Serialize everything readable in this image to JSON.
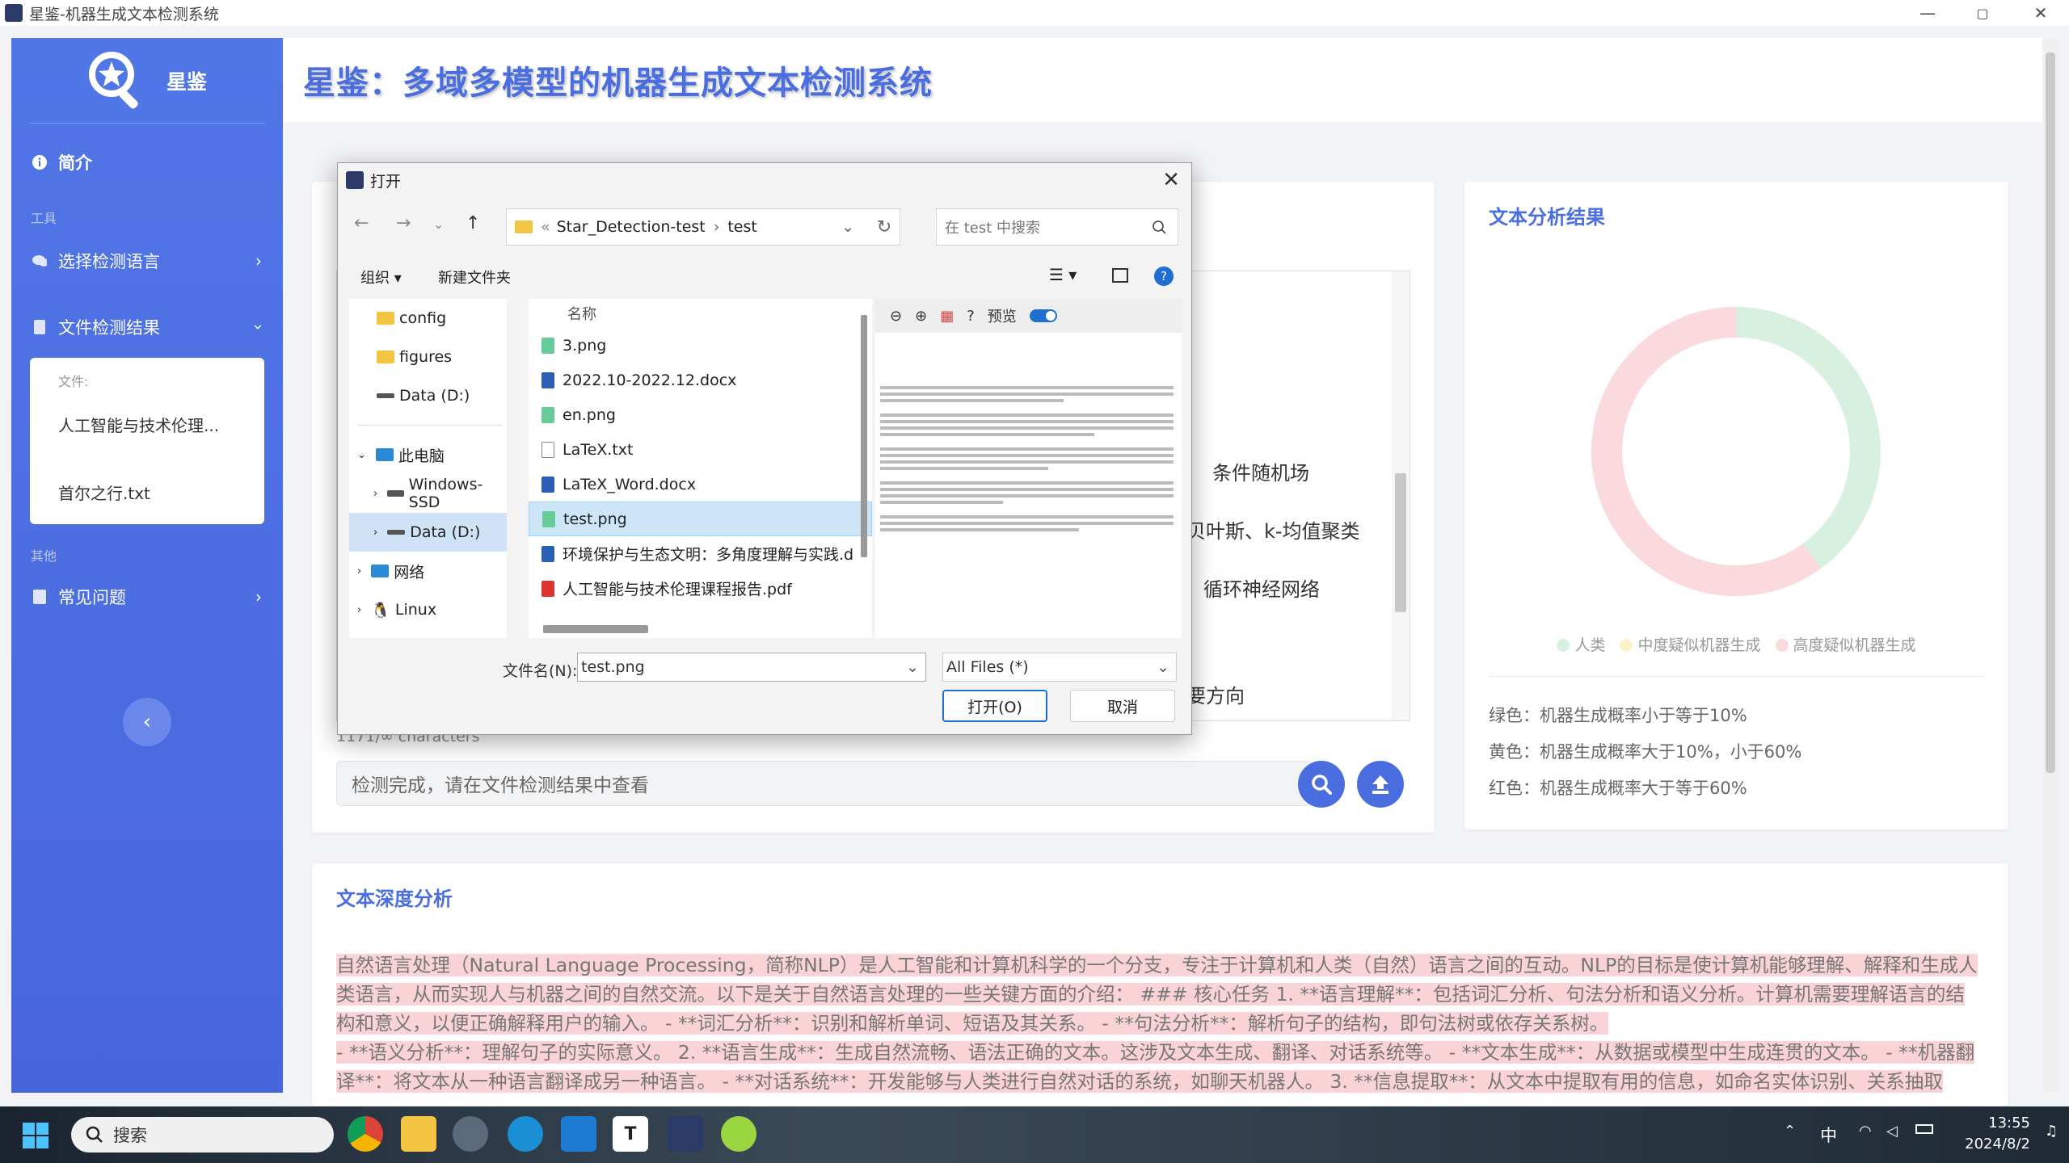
{
  "window": {
    "title": "星鉴-机器生成文本检测系统",
    "min": "—",
    "max": "▢",
    "close": "✕"
  },
  "sidebar": {
    "logo_text": "星鉴",
    "intro": "简介",
    "tools_heading": "工具",
    "select_language": "选择检测语言",
    "file_results": "文件检测结果",
    "file_heading": "文件:",
    "files": [
      "人工智能与技术伦理...",
      "首尔之行.txt"
    ],
    "other_heading": "其他",
    "faq": "常见问题",
    "collapse_icon": "‹"
  },
  "header": {
    "title": "星鉴：多域多模型的机器生成文本检测系统"
  },
  "input_card": {
    "visible_lines": [
      "条件随机场",
      "贝叶斯、k-均值聚类",
      "循环神经网络",
      "要方向"
    ],
    "char_count": "1171/∞ characters",
    "status_text": "检测完成，请在文件检测结果中查看"
  },
  "result_card": {
    "title": "文本分析结果",
    "legend": [
      "人类",
      "中度疑似机器生成",
      "高度疑似机器生成"
    ],
    "lines": [
      "绿色：机器生成概率小于等于10%",
      "黄色：机器生成概率大于10%，小于60%",
      "红色：机器生成概率大于等于60%"
    ]
  },
  "chart_data": {
    "type": "pie",
    "categories": [
      "人类",
      "中度疑似机器生成",
      "高度疑似机器生成"
    ],
    "values": [
      40,
      0,
      60
    ],
    "colors": [
      "#d7f0df",
      "#fdf2cc",
      "#fadadd"
    ]
  },
  "deep_card": {
    "title": "文本深度分析",
    "text_l1": "自然语言处理（Natural Language Processing，简称NLP）是人工智能和计算机科学的一个分支，专注于计算机和人类（自然）语言之间的互动。NLP的目标是使计算机能够理解、解释和生成人",
    "text_l2": "类语言，从而实现人与机器之间的自然交流。以下是关于自然语言处理的一些关键方面的介绍：  ### 核心任务 1. **语言理解**：包括词汇分析、句法分析和语义分析。计算机需要理解语言的结",
    "text_l3": "构和意义，以便正确解释用户的输入。 - **词汇分析**：识别和解析单词、短语及其关系。 - **句法分析**：解析句子的结构，即句法树或依存关系树。",
    "text_l4": "- **语义分析**：理解句子的实际意义。  2. **语言生成**：生成自然流畅、语法正确的文本。这涉及文本生成、翻译、对话系统等。 - **文本生成**：从数据或模型中生成连贯的文本。 - **机器翻",
    "text_l5": "译**：将文本从一种语言翻译成另一种语言。 - **对话系统**：开发能够与人类进行自然对话的系统，如聊天机器人。 3. **信息提取**：从文本中提取有用的信息，如命名实体识别、关系抽取"
  },
  "dialog": {
    "title": "打开",
    "path_prefix": "«",
    "path_root": "Star_Detection-test",
    "path_sep": "›",
    "path_leaf": "test",
    "search_placeholder": "在 test 中搜索",
    "organize": "组织 ▾",
    "new_folder": "新建文件夹",
    "tree": [
      "config",
      "figures",
      "Data (D:)",
      "此电脑",
      "Windows-SSD",
      "Data (D:)",
      "网络",
      "Linux"
    ],
    "col_name": "名称",
    "files": [
      "3.png",
      "2022.10-2022.12.docx",
      "en.png",
      "LaTeX.txt",
      "LaTeX_Word.docx",
      "test.png",
      "环境保护与生态文明：多角度理解与实践.d",
      "人工智能与技术伦理课程报告.pdf"
    ],
    "preview_label": "预览",
    "filename_label": "文件名(N):",
    "filename_value": "test.png",
    "filter_value": "All Files (*)",
    "open_button": "打开(O)",
    "cancel_button": "取消"
  },
  "taskbar": {
    "search": "搜索",
    "time": "13:55",
    "date": "2024/8/2",
    "ime": "中"
  }
}
